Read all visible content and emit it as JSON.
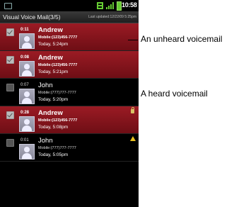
{
  "status_bar": {
    "time": "10:58"
  },
  "header": {
    "title": "Visual Voice Mail(3/5)",
    "last_updated": "Last updated:12/22/09 5:25pm"
  },
  "voicemails": [
    {
      "duration": "0:11",
      "name": "Andrew",
      "number": "Mobile:(123)456-7777",
      "time": "Today, 5:24pm",
      "state": "unheard"
    },
    {
      "duration": "0:08",
      "name": "Andrew",
      "number": "Mobile:(123)456-7777",
      "time": "Today, 5:21pm",
      "state": "unheard"
    },
    {
      "duration": "0:07",
      "name": "John",
      "number": "Mobile:(777)777-7777",
      "time": "Today, 5:20pm",
      "state": "heard"
    },
    {
      "duration": "0:28",
      "name": "Andrew",
      "number": "Mobile:(123)456-7777",
      "time": "Today, 5:08pm",
      "state": "unheard",
      "badge": "lock-icon"
    },
    {
      "duration": "0:01",
      "name": "John",
      "number": "Mobile:(777)777-7777",
      "time": "Today, 5:05pm",
      "state": "heard",
      "badge": "warning-icon"
    }
  ],
  "callouts": {
    "unheard": "An unheard voicemail",
    "heard": "A heard voicemail"
  },
  "colors": {
    "unheard_row": "#8b1520",
    "heard_row": "#000000",
    "battery": "#66cc33"
  }
}
